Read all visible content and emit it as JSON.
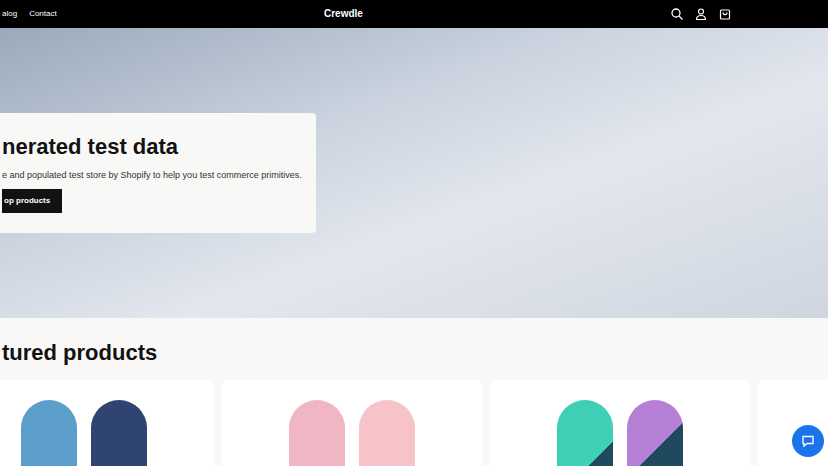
{
  "header": {
    "nav": [
      {
        "label": "alog"
      },
      {
        "label": "Contact"
      }
    ],
    "brand": "Crewdle"
  },
  "hero": {
    "heading": "nerated test data",
    "text": "e and populated test store by Shopify to help you test commerce primitives.",
    "button": "op products"
  },
  "featured": {
    "heading": "tured products"
  }
}
